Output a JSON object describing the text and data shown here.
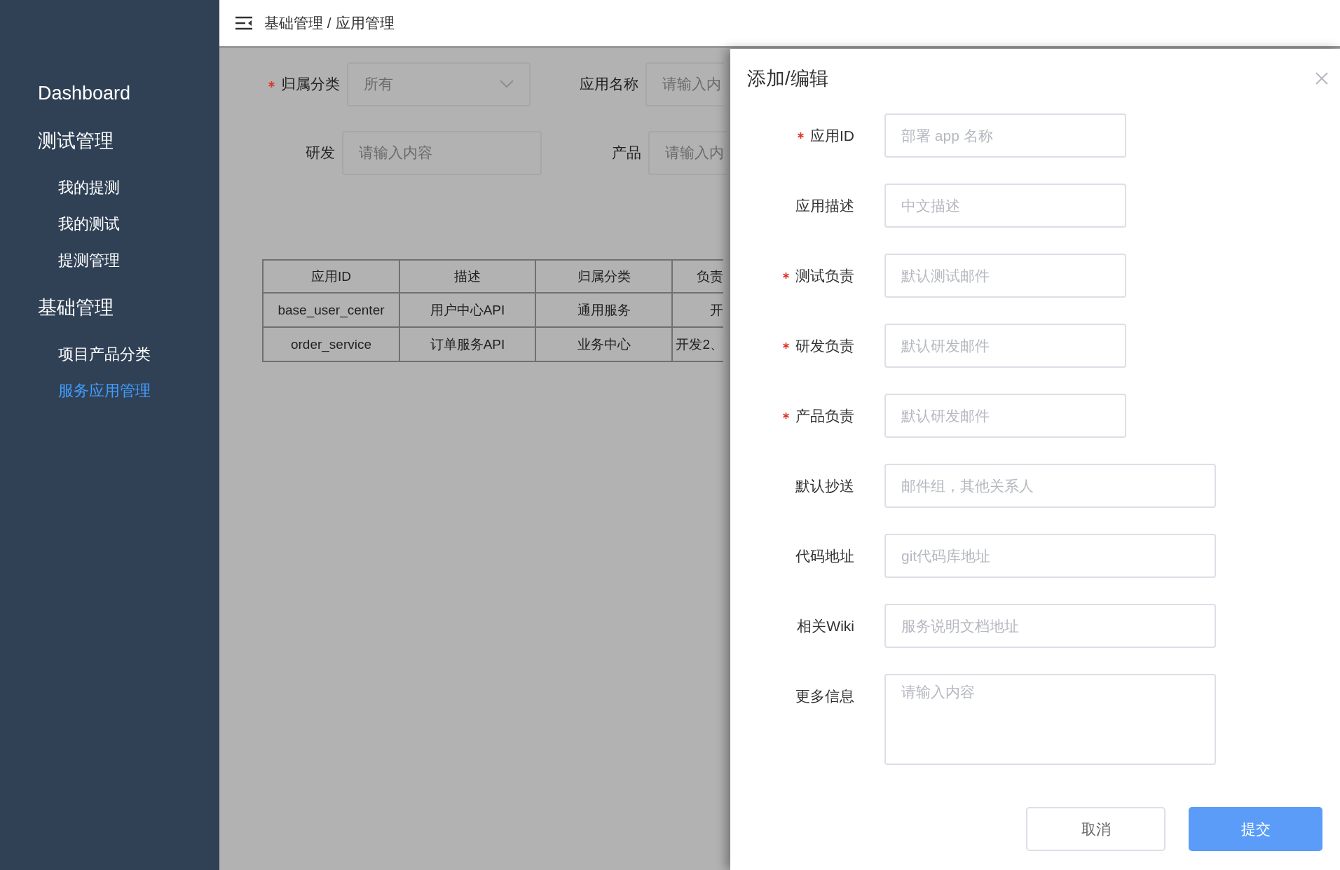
{
  "sidebar": {
    "items": [
      {
        "label": "Dashboard",
        "selected": false
      },
      {
        "label": "测试管理",
        "selected": false,
        "children": [
          {
            "label": "我的提测",
            "selected": false
          },
          {
            "label": "我的测试",
            "selected": false
          },
          {
            "label": "提测管理",
            "selected": false
          }
        ]
      },
      {
        "label": "基础管理",
        "selected": false,
        "children": [
          {
            "label": "项目产品分类",
            "selected": false
          },
          {
            "label": "服务应用管理",
            "selected": true
          }
        ]
      }
    ]
  },
  "header": {
    "breadcrumb": "基础管理 / 应用管理"
  },
  "filters": [
    {
      "label": "归属分类",
      "required": true,
      "kind": "select",
      "placeholder": "所有"
    },
    {
      "label": "应用名称",
      "required": false,
      "kind": "input",
      "placeholder": "请输入内"
    },
    {
      "label": "研发",
      "required": false,
      "kind": "input",
      "placeholder": "请输入内容"
    },
    {
      "label": "产品",
      "required": false,
      "kind": "input",
      "placeholder": "请输入内"
    }
  ],
  "table": {
    "columns": [
      "应用ID",
      "描述",
      "归属分类",
      "负责"
    ],
    "rows": [
      [
        "base_user_center",
        "用户中心API",
        "通用服务",
        "开"
      ],
      [
        "order_service",
        "订单服务API",
        "业务中心",
        "开发2、"
      ]
    ]
  },
  "drawer": {
    "title": "添加/编辑",
    "fields": [
      {
        "label": "应用ID",
        "required": true,
        "kind": "short",
        "placeholder": "部署 app 名称"
      },
      {
        "label": "应用描述",
        "required": false,
        "kind": "short",
        "placeholder": "中文描述"
      },
      {
        "label": "测试负责",
        "required": true,
        "kind": "short",
        "placeholder": "默认测试邮件"
      },
      {
        "label": "研发负责",
        "required": true,
        "kind": "short",
        "placeholder": "默认研发邮件"
      },
      {
        "label": "产品负责",
        "required": true,
        "kind": "short",
        "placeholder": "默认研发邮件"
      },
      {
        "label": "默认抄送",
        "required": false,
        "kind": "long",
        "placeholder": "邮件组，其他关系人"
      },
      {
        "label": "代码地址",
        "required": false,
        "kind": "long",
        "placeholder": "git代码库地址"
      },
      {
        "label": "相关Wiki",
        "required": false,
        "kind": "long",
        "placeholder": "服务说明文档地址"
      },
      {
        "label": "更多信息",
        "required": false,
        "kind": "textarea",
        "placeholder": "请输入内容"
      }
    ],
    "buttons": [
      {
        "label": "取消",
        "kind": "plain"
      },
      {
        "label": "提交",
        "kind": "primary"
      }
    ]
  }
}
